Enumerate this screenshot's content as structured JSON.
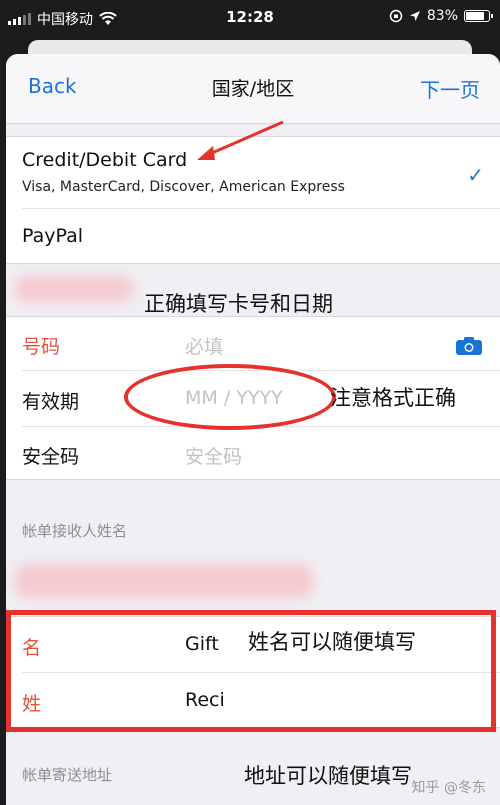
{
  "status_bar": {
    "carrier": "中国移动",
    "time": "12:28",
    "battery": "83%",
    "battery_level": 0.83
  },
  "nav": {
    "back": "Back",
    "title": "国家/地区",
    "next": "下一页"
  },
  "payment_methods": [
    {
      "title": "Credit/Debit Card",
      "subtitle": "Visa, MasterCard, Discover, American Express",
      "selected": true
    },
    {
      "title": "PayPal",
      "subtitle": "",
      "selected": false
    }
  ],
  "card_form": {
    "number_label": "号码",
    "number_placeholder": "必填",
    "expiry_label": "有效期",
    "expiry_placeholder": "MM / YYYY",
    "cvv_label": "安全码",
    "cvv_placeholder": "安全码"
  },
  "billing_name": {
    "header": "帐单接收人姓名",
    "first_label": "名",
    "first_value": "Gift",
    "last_label": "姓",
    "last_value": "Reci"
  },
  "billing_address": {
    "header": "帐单寄送地址"
  },
  "annotations": {
    "card_date": "正确填写卡号和日期",
    "format": "注意格式正确",
    "name": "姓名可以随便填写",
    "address": "地址可以随便填写"
  },
  "watermark": "知乎 @冬东",
  "colors": {
    "accent": "#1a73d9",
    "annotation_red": "#e5322d",
    "required_label": "#e0533d"
  }
}
